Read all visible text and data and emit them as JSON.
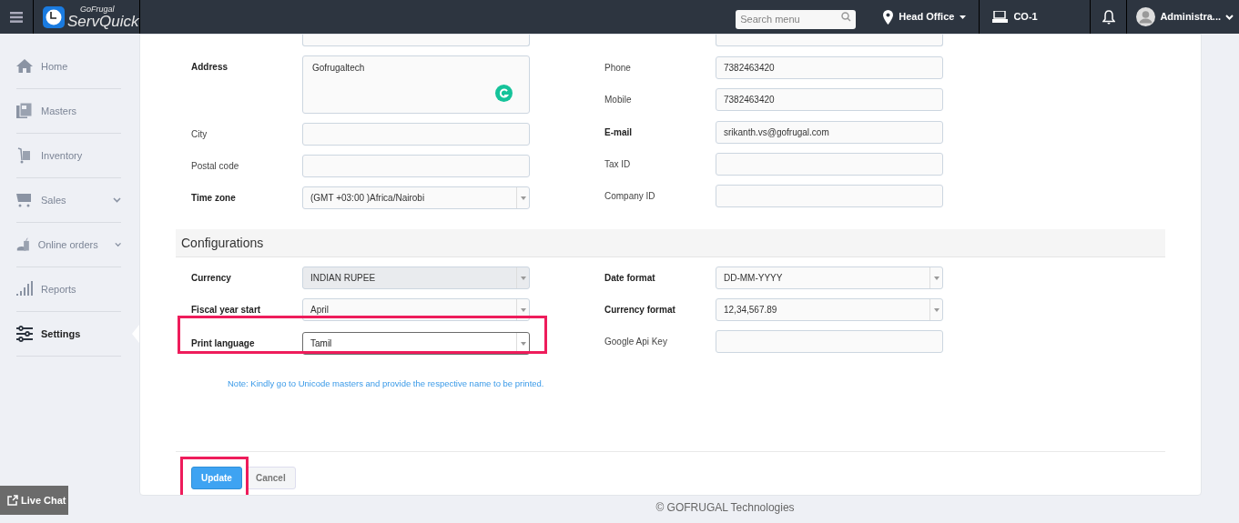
{
  "header": {
    "brand_small": "GoFrugal",
    "brand": "ServQuick",
    "search": {
      "placeholder": "Search menu"
    },
    "location": "Head Office",
    "counter": "CO-1",
    "user": "Administra..."
  },
  "sidebar": {
    "items": [
      {
        "label": "Home",
        "selected": false
      },
      {
        "label": "Masters",
        "selected": false
      },
      {
        "label": "Inventory",
        "selected": false
      },
      {
        "label": "Sales",
        "selected": false,
        "expandable": true
      },
      {
        "label": "Online orders",
        "selected": false,
        "expandable": true
      },
      {
        "label": "Reports",
        "selected": false
      },
      {
        "label": "Settings",
        "selected": true
      }
    ]
  },
  "form": {
    "left": [
      {
        "partial": true
      },
      {
        "kind": "textarea",
        "label": "Address",
        "value": "Gofrugaltech",
        "required": true
      },
      {
        "kind": "text",
        "label": "City",
        "required": false
      },
      {
        "kind": "text",
        "label": "Postal code",
        "required": false
      },
      {
        "kind": "select",
        "label": "Time zone",
        "value": "(GMT +03:00 )Africa/Nairobi",
        "required": true
      }
    ],
    "right": [
      {
        "partial": true
      },
      {
        "kind": "text",
        "label": "Phone",
        "value": "7382463420",
        "required": false
      },
      {
        "kind": "text",
        "label": "Mobile",
        "value": "7382463420",
        "required": false
      },
      {
        "kind": "text",
        "label": "E-mail",
        "value": "srikanth.vs@gofrugal.com",
        "required": true
      },
      {
        "kind": "text",
        "label": "Tax ID",
        "required": false
      },
      {
        "kind": "text",
        "label": "Company ID",
        "required": false
      }
    ]
  },
  "configurations": {
    "title": "Configurations",
    "left": [
      {
        "kind": "select",
        "label": "Currency",
        "value": "INDIAN RUPEE",
        "required": true,
        "disabled": true
      },
      {
        "kind": "select",
        "label": "Fiscal year start",
        "value": "April",
        "required": true,
        "disabled": false
      },
      {
        "kind": "select",
        "label": "Print language",
        "value": "Tamil",
        "required": true,
        "disabled": false,
        "highlighted": true
      }
    ],
    "right": [
      {
        "kind": "select",
        "label": "Date format",
        "value": "DD-MM-YYYY",
        "required": true,
        "disabled": false
      },
      {
        "kind": "select",
        "label": "Currency format",
        "value": "12,34,567.89",
        "required": true,
        "disabled": false
      },
      {
        "kind": "text",
        "label": "Google Api Key",
        "required": false,
        "disabled": false
      }
    ],
    "note": "Note: Kindly go to Unicode masters and provide the respective name to be printed."
  },
  "buttons": [
    {
      "label": "Update",
      "kind": "primary",
      "highlighted": true
    },
    {
      "label": "Cancel",
      "kind": "secondary",
      "highlighted": false
    }
  ],
  "live_chat": "Live Chat",
  "footer": "© GOFRUGAL Technologies"
}
